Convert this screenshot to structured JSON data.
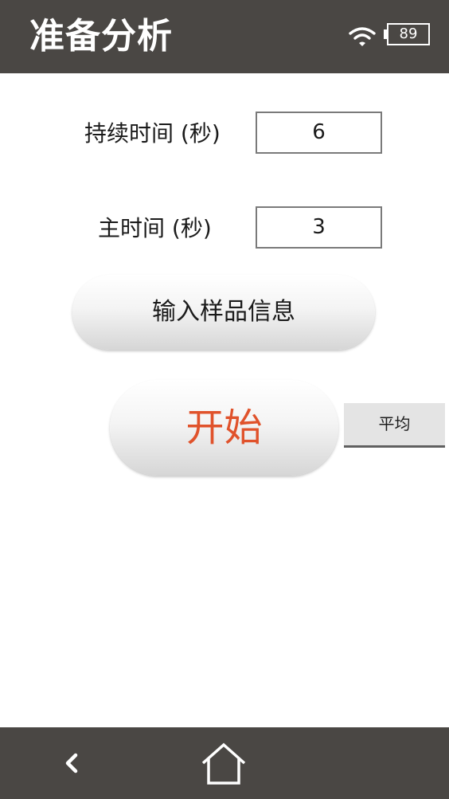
{
  "header": {
    "title": "准备分析",
    "wifi_icon": "wifi-icon",
    "battery_level": "89"
  },
  "form": {
    "duration": {
      "label": "持续时间 (秒)",
      "value": "6"
    },
    "main_time": {
      "label": "主时间 (秒)",
      "value": "3"
    }
  },
  "buttons": {
    "sample_info": "输入样品信息",
    "start": "开始",
    "average": "平均"
  },
  "colors": {
    "bar_background": "#4a4744",
    "start_text": "#e0522b"
  },
  "nav": {
    "back_icon": "chevron-left-icon",
    "home_icon": "home-icon"
  }
}
